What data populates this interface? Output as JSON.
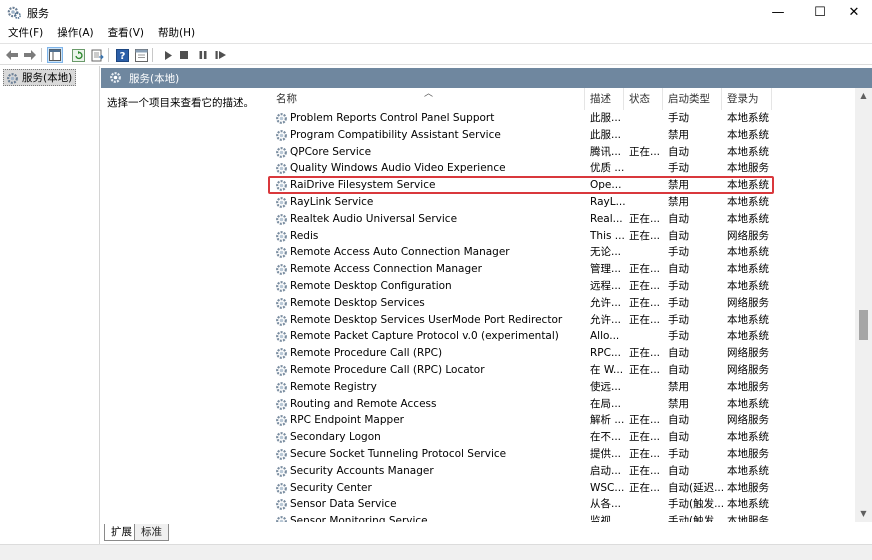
{
  "window": {
    "title": "服务",
    "minimize": "—",
    "maximize": "☐",
    "close": "✕"
  },
  "menu": [
    "文件(F)",
    "操作(A)",
    "查看(V)",
    "帮助(H)"
  ],
  "tree": {
    "root_label": "服务(本地)"
  },
  "right_header": "服务(本地)",
  "description_prompt": "选择一个项目来查看它的描述。",
  "columns": {
    "name": "名称",
    "description": "描述",
    "status": "状态",
    "startup_type": "启动类型",
    "log_on_as": "登录为"
  },
  "services": [
    {
      "name": "Problem Reports Control Panel Support",
      "desc": "此服...",
      "status": "",
      "startup": "手动",
      "logon": "本地系统"
    },
    {
      "name": "Program Compatibility Assistant Service",
      "desc": "此服...",
      "status": "",
      "startup": "禁用",
      "logon": "本地系统"
    },
    {
      "name": "QPCore Service",
      "desc": "腾讯...",
      "status": "正在...",
      "startup": "自动",
      "logon": "本地系统"
    },
    {
      "name": "Quality Windows Audio Video Experience",
      "desc": "优质 ...",
      "status": "",
      "startup": "手动",
      "logon": "本地服务"
    },
    {
      "name": "RaiDrive Filesystem Service",
      "desc": "Ope...",
      "status": "",
      "startup": "禁用",
      "logon": "本地系统"
    },
    {
      "name": "RayLink Service",
      "desc": "RayL...",
      "status": "",
      "startup": "禁用",
      "logon": "本地系统"
    },
    {
      "name": "Realtek Audio Universal Service",
      "desc": "Real...",
      "status": "正在...",
      "startup": "自动",
      "logon": "本地系统"
    },
    {
      "name": "Redis",
      "desc": "This ...",
      "status": "正在...",
      "startup": "自动",
      "logon": "网络服务"
    },
    {
      "name": "Remote Access Auto Connection Manager",
      "desc": "无论...",
      "status": "",
      "startup": "手动",
      "logon": "本地系统"
    },
    {
      "name": "Remote Access Connection Manager",
      "desc": "管理...",
      "status": "正在...",
      "startup": "自动",
      "logon": "本地系统"
    },
    {
      "name": "Remote Desktop Configuration",
      "desc": "远程...",
      "status": "正在...",
      "startup": "手动",
      "logon": "本地系统"
    },
    {
      "name": "Remote Desktop Services",
      "desc": "允许...",
      "status": "正在...",
      "startup": "手动",
      "logon": "网络服务"
    },
    {
      "name": "Remote Desktop Services UserMode Port Redirector",
      "desc": "允许...",
      "status": "正在...",
      "startup": "手动",
      "logon": "本地系统"
    },
    {
      "name": "Remote Packet Capture Protocol v.0 (experimental)",
      "desc": "Allo...",
      "status": "",
      "startup": "手动",
      "logon": "本地系统"
    },
    {
      "name": "Remote Procedure Call (RPC)",
      "desc": "RPC...",
      "status": "正在...",
      "startup": "自动",
      "logon": "网络服务"
    },
    {
      "name": "Remote Procedure Call (RPC) Locator",
      "desc": "在 W...",
      "status": "正在...",
      "startup": "自动",
      "logon": "网络服务"
    },
    {
      "name": "Remote Registry",
      "desc": "使远...",
      "status": "",
      "startup": "禁用",
      "logon": "本地服务"
    },
    {
      "name": "Routing and Remote Access",
      "desc": "在局...",
      "status": "",
      "startup": "禁用",
      "logon": "本地系统"
    },
    {
      "name": "RPC Endpoint Mapper",
      "desc": "解析 ...",
      "status": "正在...",
      "startup": "自动",
      "logon": "网络服务"
    },
    {
      "name": "Secondary Logon",
      "desc": "在不...",
      "status": "正在...",
      "startup": "自动",
      "logon": "本地系统"
    },
    {
      "name": "Secure Socket Tunneling Protocol Service",
      "desc": "提供...",
      "status": "正在...",
      "startup": "手动",
      "logon": "本地服务"
    },
    {
      "name": "Security Accounts Manager",
      "desc": "启动...",
      "status": "正在...",
      "startup": "自动",
      "logon": "本地系统"
    },
    {
      "name": "Security Center",
      "desc": "WSC...",
      "status": "正在...",
      "startup": "自动(延迟...",
      "logon": "本地服务"
    },
    {
      "name": "Sensor Data Service",
      "desc": "从各...",
      "status": "",
      "startup": "手动(触发...",
      "logon": "本地系统"
    },
    {
      "name": "Sensor Monitoring Service",
      "desc": "监视...",
      "status": "",
      "startup": "手动(触发...",
      "logon": "本地服务"
    }
  ],
  "highlighted_service_index": 4,
  "tabs": {
    "extended": "扩展",
    "standard": "标准"
  },
  "icons": {
    "app": "services-gear-icon",
    "service": "service-gear-icon",
    "highlight_color": "#d9383c",
    "header_bg": "#6f879f"
  }
}
